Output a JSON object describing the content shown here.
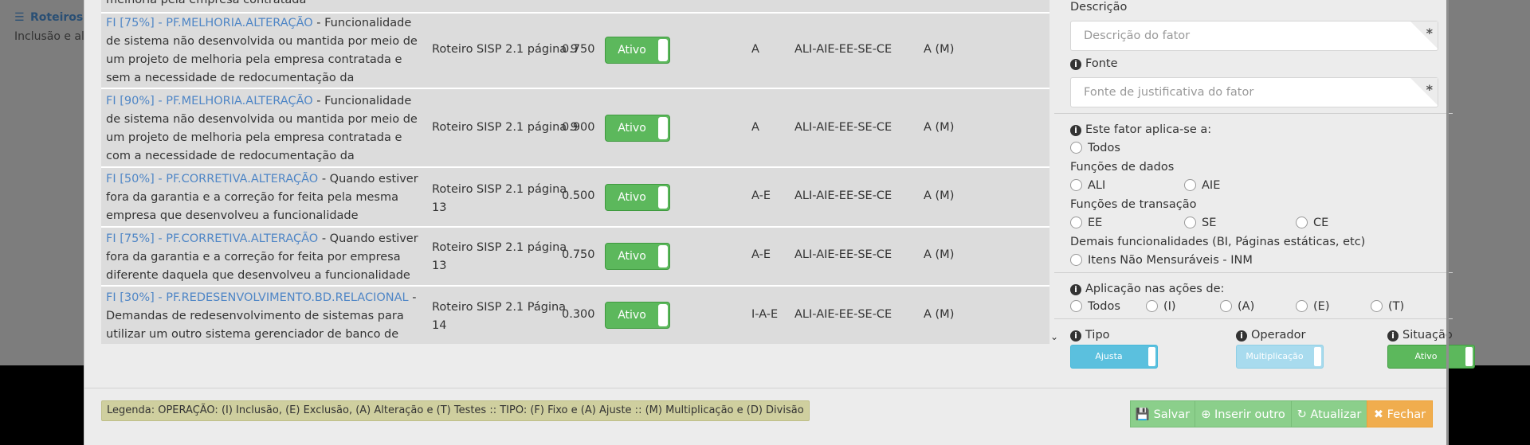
{
  "background": {
    "title": "Roteiros",
    "subtitle": "Inclusão e alt"
  },
  "table": {
    "top_partial_text": "melhoria pela empresa contratada",
    "rows": [
      {
        "code": "FI [75%] - PF.MELHORIA.ALTERAÇÃO",
        "desc": " - Funcionalidade de sistema não desenvolvida ou mantida por meio de um projeto de melhoria pela empresa contratada e sem a necessidade de redocumentação da funcionalidade",
        "roteiro": "Roteiro SISP 2.1 página 9",
        "valor": "0.750",
        "status": "Ativo",
        "operacao": "A",
        "funcoes": "ALI-AIE-EE-SE-CE",
        "tipo": "A (M)"
      },
      {
        "code": "FI [90%] - PF.MELHORIA.ALTERAÇÃO",
        "desc": " - Funcionalidade de sistema não desenvolvida ou mantida por meio de um projeto de melhoria pela empresa contratada e com a necessidade de redocumentação da funcionalidade",
        "roteiro": "Roteiro SISP 2.1 página 9",
        "valor": "0.900",
        "status": "Ativo",
        "operacao": "A",
        "funcoes": "ALI-AIE-EE-SE-CE",
        "tipo": "A (M)"
      },
      {
        "code": "FI [50%] - PF.CORRETIVA.ALTERAÇÃO",
        "desc": " - Quando estiver fora da garantia e a correção for feita pela mesma empresa que desenvolveu a funcionalidade",
        "roteiro": "Roteiro SISP 2.1 página 13",
        "valor": "0.500",
        "status": "Ativo",
        "operacao": "A-E",
        "funcoes": "ALI-AIE-EE-SE-CE",
        "tipo": "A (M)"
      },
      {
        "code": "FI [75%] - PF.CORRETIVA.ALTERAÇÃO",
        "desc": " - Quando estiver fora da garantia e a correção for feita por empresa diferente daquela que desenvolveu a funcionalidade",
        "roteiro": "Roteiro SISP 2.1 página 13",
        "valor": "0.750",
        "status": "Ativo",
        "operacao": "A-E",
        "funcoes": "ALI-AIE-EE-SE-CE",
        "tipo": "A (M)"
      },
      {
        "code": "FI [30%] - PF.REDESENVOLVIMENTO.BD.RELACIONAL",
        "desc": " - Demandas de redesenvolvimento de sistemas para utilizar um outro sistema gerenciador de banco de dados",
        "roteiro": "Roteiro SISP 2.1 Página 14",
        "valor": "0.300",
        "status": "Ativo",
        "operacao": "I-A-E",
        "funcoes": "ALI-AIE-EE-SE-CE",
        "tipo": "A (M)"
      }
    ],
    "scroll_icon": "chevron-down-icon"
  },
  "form": {
    "descricao_label": "Descrição",
    "descricao_placeholder": "Descrição do fator",
    "fonte_label": "Fonte",
    "fonte_placeholder": "Fonte de justificativa do fator",
    "required_mark": "*",
    "aplica_label": "Este fator aplica-se a:",
    "todos": "Todos",
    "funcoes_dados_label": "Funções de dados",
    "ali": "ALI",
    "aie": "AIE",
    "funcoes_transacao_label": "Funções de transação",
    "ee": "EE",
    "se": "SE",
    "ce": "CE",
    "demais_label": "Demais funcionalidades (BI, Páginas estáticas, etc)",
    "inm": "Itens Não Mensuráveis - INM",
    "aplicacao_label": "Aplicação nas ações de:",
    "acoes_todos": "Todos",
    "acao_i": "(I)",
    "acao_a": "(A)",
    "acao_e": "(E)",
    "acao_t": "(T)",
    "tipo_label": "Tipo",
    "tipo_value": "Ajusta",
    "operador_label": "Operador",
    "operador_value": "Multiplicação",
    "situacao_label": "Situação",
    "situacao_value": "Ativo",
    "info_icon": "info-icon"
  },
  "footer": {
    "legend": "Legenda:   OPERAÇÃO: (I) Inclusão, (E) Exclusão, (A) Alteração e (T) Testes ::  TIPO: (F) Fixo e (A) Ajuste  ::  (M) Multiplicação e (D) Divisão",
    "salvar": "Salvar",
    "inserir": "Inserir outro",
    "atualizar": "Atualizar",
    "fechar": "Fechar"
  },
  "colors": {
    "link": "#4f86c6",
    "success": "#5cb85c",
    "info": "#5bc0de",
    "warning": "#f0ad4e"
  }
}
